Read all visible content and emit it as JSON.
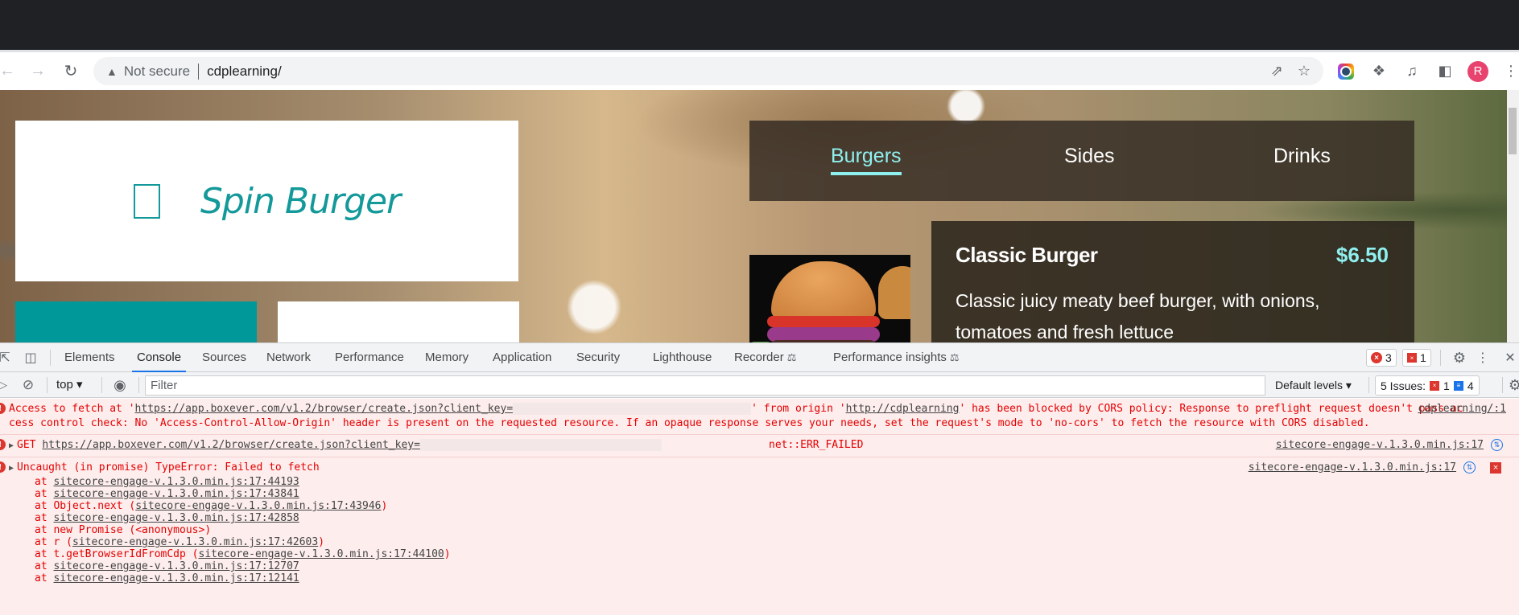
{
  "browser": {
    "security_label": "Not secure",
    "url": "cdplearning/",
    "profile_initial": "R",
    "icons": [
      "back-icon",
      "forward-icon",
      "reload-icon",
      "warning-icon",
      "share-icon",
      "star-icon",
      "lens-extension-icon",
      "extensions-icon",
      "media-icon",
      "side-panel-icon",
      "avatar",
      "menu-icon"
    ]
  },
  "site": {
    "logo_text": "Spin Burger",
    "menu_tabs": [
      {
        "label": "Burgers",
        "active": true
      },
      {
        "label": "Sides",
        "active": false
      },
      {
        "label": "Drinks",
        "active": false
      }
    ],
    "item": {
      "name": "Classic Burger",
      "price": "$6.50",
      "description": "Classic juicy meaty beef burger, with onions, tomatoes and fresh lettuce"
    },
    "colors": {
      "brand": "#14999a",
      "accent": "#8ff0f0"
    }
  },
  "devtools": {
    "tabs": [
      {
        "label": "Elements"
      },
      {
        "label": "Console",
        "active": true
      },
      {
        "label": "Sources"
      },
      {
        "label": "Network"
      },
      {
        "label": "Performance"
      },
      {
        "label": "Memory"
      },
      {
        "label": "Application"
      },
      {
        "label": "Security"
      },
      {
        "label": "Lighthouse"
      },
      {
        "label": "Recorder"
      },
      {
        "label": "Performance insights"
      }
    ],
    "error_count": "3",
    "issue_count": "1",
    "context": "top",
    "filter_placeholder": "Filter",
    "levels_label": "Default levels",
    "issues_label": "5 Issues:",
    "issues_red": "1",
    "issues_blue": "4"
  },
  "console": {
    "messages": [
      {
        "prefix": "Access to fetch at '",
        "url": "https://app.boxever.com/v1.2/browser/create.json?client_key=",
        "mid": "' from origin '",
        "origin": "http://cdplearning",
        "rest": "' has been blocked by CORS policy: Response to preflight request doesn't pass access control check: No 'Access-Control-Allow-Origin' header is present on the requested resource. If an opaque response serves your needs, set the request's mode to 'no-cors' to fetch the resource with CORS disabled.",
        "source": "cdplearning/:1"
      },
      {
        "method": "GET",
        "url": "https://app.boxever.com/v1.2/browser/create.json?client_key=",
        "status": "net::ERR_FAILED",
        "source": "sitecore-engage-v.1.3.0.min.js:17"
      },
      {
        "text": "Uncaught (in promise) TypeError: Failed to fetch",
        "source": "sitecore-engage-v.1.3.0.min.js:17",
        "stack": [
          {
            "pre": "at ",
            "link": "sitecore-engage-v.1.3.0.min.js:17:44193",
            "post": ""
          },
          {
            "pre": "at ",
            "link": "sitecore-engage-v.1.3.0.min.js:17:43841",
            "post": ""
          },
          {
            "pre": "at Object.next (",
            "link": "sitecore-engage-v.1.3.0.min.js:17:43946",
            "post": ")"
          },
          {
            "pre": "at ",
            "link": "sitecore-engage-v.1.3.0.min.js:17:42858",
            "post": ""
          },
          {
            "pre": "at new Promise (<anonymous>)",
            "link": "",
            "post": ""
          },
          {
            "pre": "at r (",
            "link": "sitecore-engage-v.1.3.0.min.js:17:42603",
            "post": ")"
          },
          {
            "pre": "at t.getBrowserIdFromCdp (",
            "link": "sitecore-engage-v.1.3.0.min.js:17:44100",
            "post": ")"
          },
          {
            "pre": "at ",
            "link": "sitecore-engage-v.1.3.0.min.js:17:12707",
            "post": ""
          },
          {
            "pre": "at ",
            "link": "sitecore-engage-v.1.3.0.min.js:17:12141",
            "post": ""
          }
        ]
      }
    ]
  }
}
